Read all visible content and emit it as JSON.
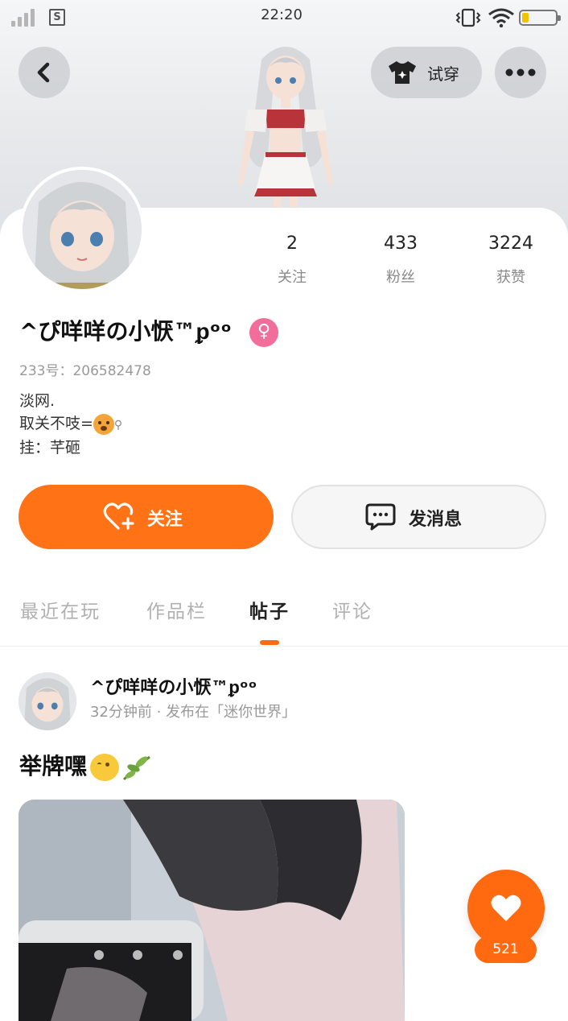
{
  "status_bar": {
    "time": "22:20",
    "sim_label": "S"
  },
  "header": {
    "try_on_label": "试穿"
  },
  "profile": {
    "username": "^ぴ咩咩の小恹™ᵱᵒᵒ",
    "gender_symbol": "♀",
    "uid_text": "233号：206582478",
    "bio_lines": [
      "淡网.",
      "取关不吱=",
      "挂：芊砸"
    ],
    "bio_pin": "⚲",
    "stats": [
      {
        "value": "2",
        "label": "关注"
      },
      {
        "value": "433",
        "label": "粉丝"
      },
      {
        "value": "3224",
        "label": "获赞"
      }
    ]
  },
  "actions": {
    "follow_label": "关注",
    "message_label": "发消息"
  },
  "tabs": [
    {
      "label": "最近在玩",
      "active": false
    },
    {
      "label": "作品栏",
      "active": false
    },
    {
      "label": "帖子",
      "active": true
    },
    {
      "label": "评论",
      "active": false
    }
  ],
  "post": {
    "author": "^ぴ咩咩の小恹™ᵱᵒᵒ",
    "meta": "32分钟前 · 发布在「迷你世界」",
    "text": "举牌嘿"
  },
  "like": {
    "count": "521"
  },
  "colors": {
    "accent": "#ff7216",
    "gender_badge": "#f26d9a"
  }
}
